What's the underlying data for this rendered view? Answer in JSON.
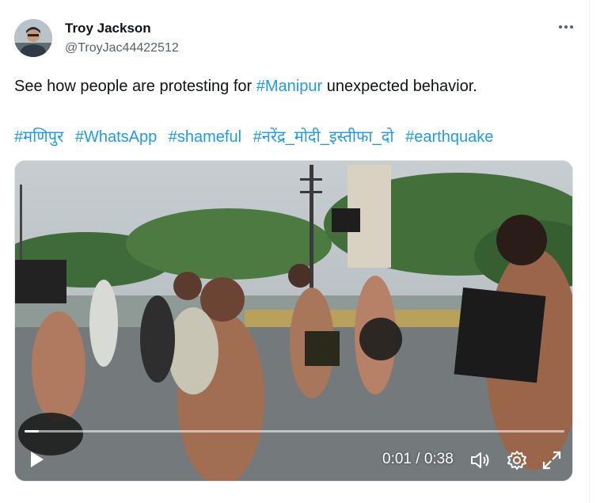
{
  "tweet": {
    "author_name": "Troy Jackson",
    "author_handle": "@TroyJac44422512",
    "more_icon": "more-horizontal-icon",
    "text_before": "See how people are protesting for ",
    "text_link": "#Manipur",
    "text_after": " unexpected behavior.",
    "hashtags": [
      "#मणिपुर",
      "#WhatsApp",
      "#shameful",
      "#नरेंद्र_मोदी_इस्तीफा_दो",
      "#earthquake"
    ]
  },
  "video": {
    "time_display": "0:01 / 0:38",
    "progress_fraction": 0.026,
    "controls": [
      "play-icon",
      "volume-icon",
      "settings-icon",
      "fullscreen-icon"
    ]
  },
  "colors": {
    "link": "#1d9bf0",
    "text": "#0f1419",
    "muted": "#536471"
  }
}
